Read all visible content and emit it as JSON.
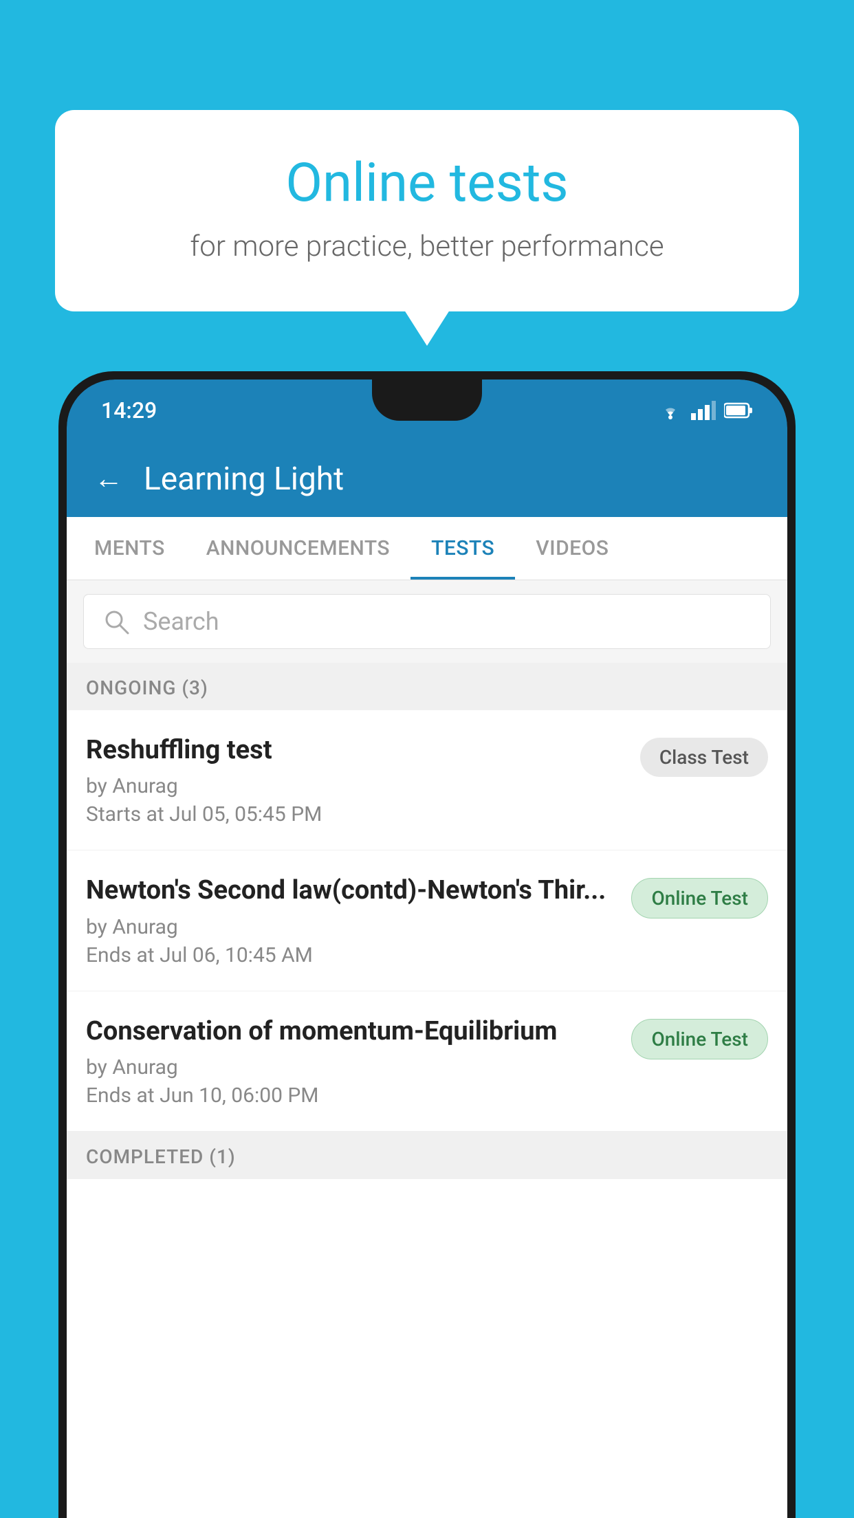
{
  "background_color": "#22b8e0",
  "bubble": {
    "title": "Online tests",
    "subtitle": "for more practice, better performance"
  },
  "phone": {
    "status_bar": {
      "time": "14:29",
      "wifi": "▼",
      "signal": "▲",
      "battery": "▐"
    },
    "app_header": {
      "back_label": "←",
      "title": "Learning Light"
    },
    "tabs": [
      {
        "label": "MENTS",
        "active": false
      },
      {
        "label": "ANNOUNCEMENTS",
        "active": false
      },
      {
        "label": "TESTS",
        "active": true
      },
      {
        "label": "VIDEOS",
        "active": false
      }
    ],
    "search": {
      "placeholder": "Search"
    },
    "ongoing_section": {
      "title": "ONGOING (3)"
    },
    "tests": [
      {
        "name": "Reshuffling test",
        "author": "by Anurag",
        "time_label": "Starts at",
        "time": "Jul 05, 05:45 PM",
        "badge": "Class Test",
        "badge_type": "class"
      },
      {
        "name": "Newton's Second law(contd)-Newton's Thir...",
        "author": "by Anurag",
        "time_label": "Ends at",
        "time": "Jul 06, 10:45 AM",
        "badge": "Online Test",
        "badge_type": "online"
      },
      {
        "name": "Conservation of momentum-Equilibrium",
        "author": "by Anurag",
        "time_label": "Ends at",
        "time": "Jun 10, 06:00 PM",
        "badge": "Online Test",
        "badge_type": "online"
      }
    ],
    "completed_section": {
      "title": "COMPLETED (1)"
    }
  }
}
